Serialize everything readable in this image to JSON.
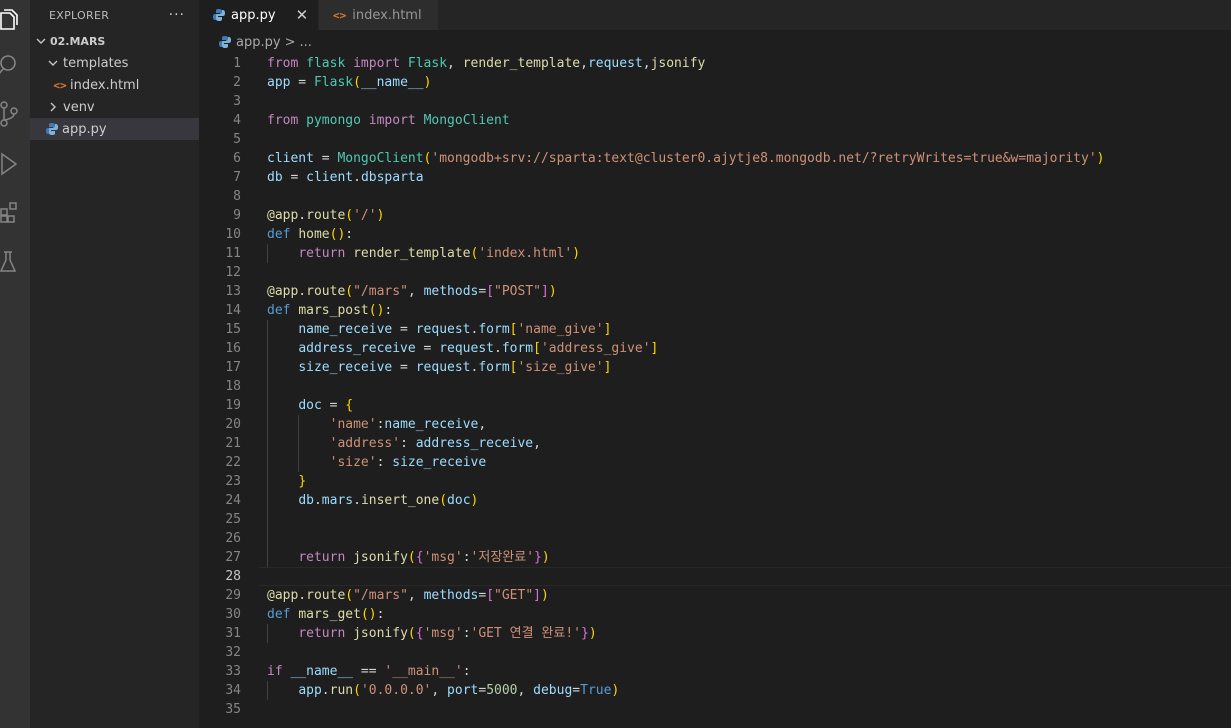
{
  "sidebar": {
    "title": "EXPLORER",
    "more": "···",
    "folder": "02.MARS",
    "items": [
      {
        "label": "templates",
        "type": "folder-open"
      },
      {
        "label": "index.html",
        "type": "html"
      },
      {
        "label": "venv",
        "type": "folder-closed"
      },
      {
        "label": "app.py",
        "type": "python"
      }
    ]
  },
  "tabs": [
    {
      "label": "app.py",
      "active": true,
      "close": "✕"
    },
    {
      "label": "index.html",
      "active": false
    }
  ],
  "breadcrumb": {
    "file": "app.py",
    "sep": ">",
    "rest": "..."
  },
  "editor": {
    "current_line": 28,
    "line_numbers": [
      "1",
      "2",
      "3",
      "4",
      "5",
      "6",
      "7",
      "8",
      "9",
      "10",
      "11",
      "12",
      "13",
      "14",
      "15",
      "16",
      "17",
      "18",
      "19",
      "20",
      "21",
      "22",
      "23",
      "24",
      "25",
      "26",
      "27",
      "28",
      "29",
      "30",
      "31",
      "32",
      "33",
      "34",
      "35"
    ]
  },
  "colors": {
    "keyword": "#c586c0",
    "function": "#dcdcaa",
    "string": "#ce9178",
    "class": "#4ec9b0",
    "variable": "#9cdcfe"
  }
}
